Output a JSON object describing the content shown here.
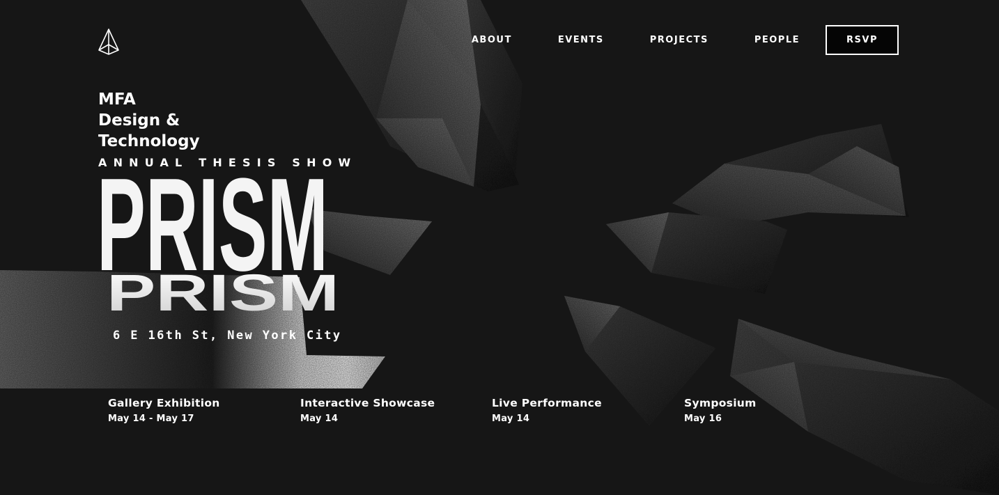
{
  "logo": {
    "icon": "prism-logo-icon"
  },
  "nav": {
    "items": [
      "ABOUT",
      "EVENTS",
      "PROJECTS",
      "PEOPLE"
    ],
    "cta": "RSVP"
  },
  "hero": {
    "program_line1": "MFA",
    "program_line2": "Design &",
    "program_line3": "Technology",
    "subtitle": "ANNUAL THESIS SHOW",
    "title": "PRISM",
    "address": "6 E 16th St, New York City"
  },
  "events": [
    {
      "name": "Gallery Exhibition",
      "date": "May 14 - May 17"
    },
    {
      "name": "Interactive Showcase",
      "date": "May 14"
    },
    {
      "name": "Live Performance",
      "date": "May 14"
    },
    {
      "name": "Symposium",
      "date": "May 16"
    }
  ],
  "colors": {
    "background": "#161616",
    "text": "#ffffff",
    "button_fill": "#050505"
  }
}
